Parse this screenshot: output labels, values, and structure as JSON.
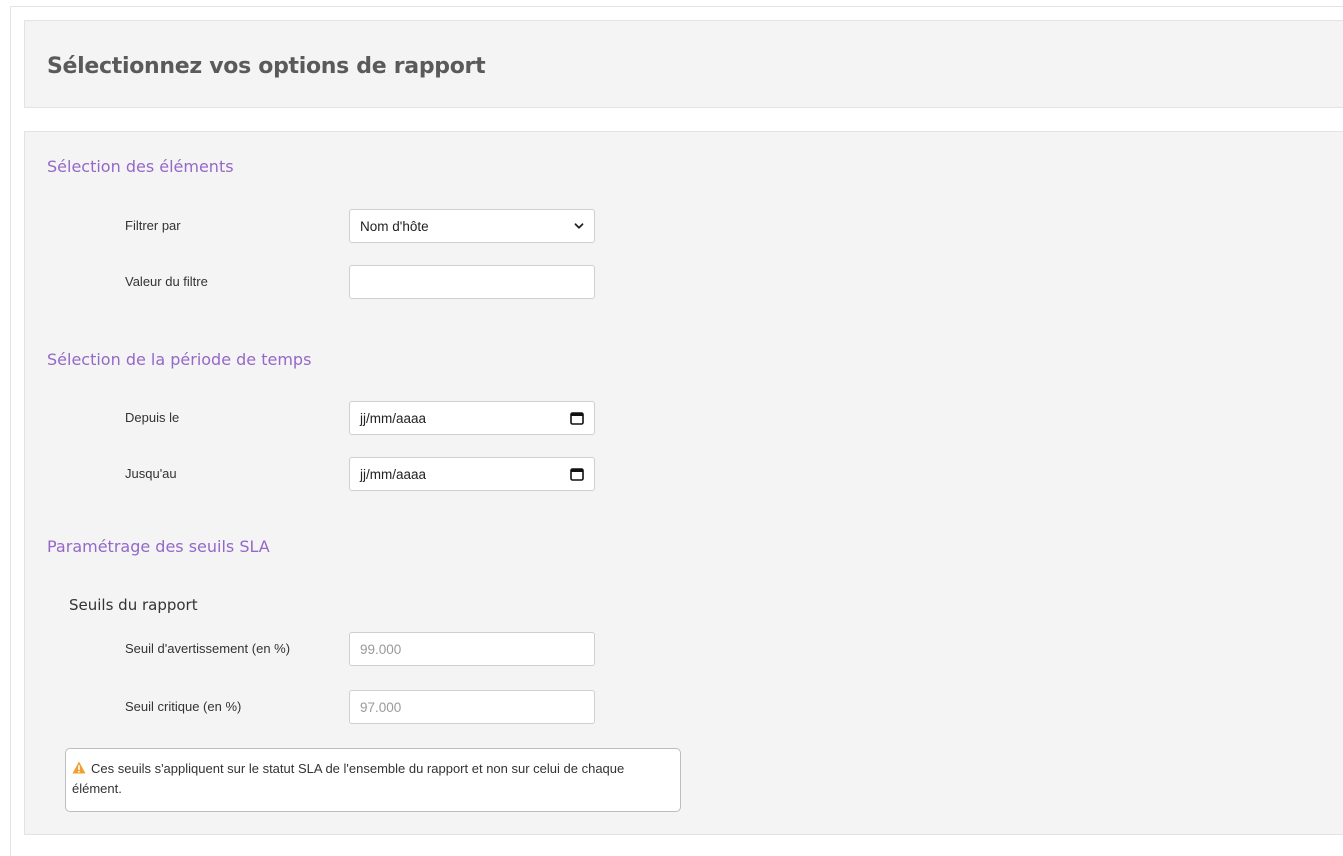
{
  "header": {
    "title": "Sélectionnez vos options de rapport"
  },
  "sections": {
    "elements": {
      "title": "Sélection des éléments",
      "filter_by_label": "Filtrer par",
      "filter_by_value": "Nom d'hôte",
      "filter_value_label": "Valeur du filtre",
      "filter_value_value": ""
    },
    "period": {
      "title": "Sélection de la période de temps",
      "from_label": "Depuis le",
      "from_placeholder": "jj/mm/aaaa",
      "to_label": "Jusqu'au",
      "to_placeholder": "jj/mm/aaaa"
    },
    "sla": {
      "title": "Paramétrage des seuils SLA",
      "subtitle": "Seuils du rapport",
      "warning_label": "Seuil d'avertissement (en %)",
      "warning_value": "99.000",
      "critical_label": "Seuil critique (en %)",
      "critical_value": "97.000",
      "note": "Ces seuils s'appliquent sur le statut SLA de l'ensemble du rapport et non sur celui de chaque élément."
    }
  },
  "icons": {
    "select": "chevron-down-icon",
    "date": "calendar-icon",
    "note": "warning-icon"
  },
  "colors": {
    "section_title": "#9468c8",
    "warning": "#f0a030",
    "panel_bg": "#f4f4f4"
  }
}
